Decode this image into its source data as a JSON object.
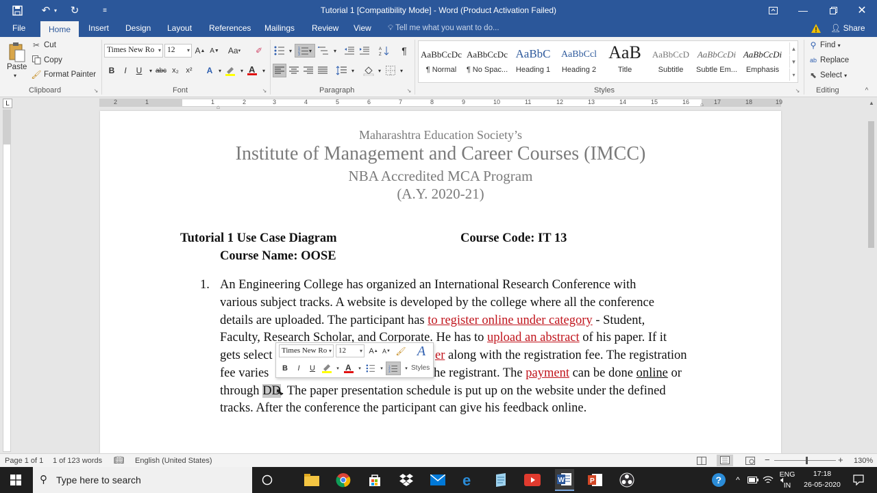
{
  "window": {
    "title": "Tutorial 1 [Compatibility Mode] - Word (Product Activation Failed)"
  },
  "quick_access": {
    "save_icon": "save-icon",
    "undo_icon": "undo-icon",
    "redo_icon": "redo-icon",
    "customize_icon": "customize-icon"
  },
  "tabs": [
    "File",
    "Home",
    "Insert",
    "Design",
    "Layout",
    "References",
    "Mailings",
    "Review",
    "View"
  ],
  "active_tab": "Home",
  "tell_me": "Tell me what you want to do...",
  "share": "Share",
  "clipboard": {
    "paste": "Paste",
    "cut": "Cut",
    "copy": "Copy",
    "format_painter": "Format Painter",
    "label": "Clipboard"
  },
  "font": {
    "name": "Times New Ro",
    "size": "12",
    "label": "Font",
    "grow": "A",
    "shrink": "A",
    "case": "Aa",
    "bold": "B",
    "italic": "I",
    "underline": "U",
    "strike": "abc",
    "sub": "x₂",
    "sup": "x²"
  },
  "paragraph": {
    "label": "Paragraph"
  },
  "styles": {
    "label": "Styles",
    "items": [
      {
        "preview": "AaBbCcDc",
        "name": "¶ Normal"
      },
      {
        "preview": "AaBbCcDc",
        "name": "¶ No Spac..."
      },
      {
        "preview": "AaBbC",
        "name": "Heading 1"
      },
      {
        "preview": "AaBbCcl",
        "name": "Heading 2"
      },
      {
        "preview": "AaB",
        "name": "Title"
      },
      {
        "preview": "AaBbCcD",
        "name": "Subtitle"
      },
      {
        "preview": "AaBbCcDi",
        "name": "Subtle Em..."
      },
      {
        "preview": "AaBbCcDi",
        "name": "Emphasis"
      }
    ]
  },
  "editing": {
    "find": "Find",
    "replace": "Replace",
    "select": "Select",
    "label": "Editing"
  },
  "ruler": {
    "numbers": [
      "2",
      "1",
      "1",
      "2",
      "3",
      "4",
      "5",
      "6",
      "7",
      "8",
      "9",
      "10",
      "11",
      "12",
      "13",
      "14",
      "15",
      "16",
      "17",
      "18",
      "19"
    ]
  },
  "document": {
    "header1": "Maharashtra Education Society’s",
    "header2": "Institute of Management and Career Courses (IMCC)",
    "header3": "NBA Accredited MCA Program",
    "header4": "(A.Y. 2020-21)",
    "tutorial": "Tutorial 1 Use Case Diagram",
    "course_code": "Course Code: IT 13",
    "course_name": "Course Name: OOSE",
    "list_num": "1.",
    "l1": "An Engineering College has organized an International Research Conference with",
    "l2": "various subject tracks. A website is developed by the college where all the conference",
    "l3a": "details are uploaded. The participant has ",
    "l3b": "to register online under category",
    "l3c": " - Student,",
    "l4a": "Faculty, Research Scholar, and Corporate. He has to ",
    "l4b": "upload an abstract",
    "l4c": " of his paper. If it",
    "l5a": "gets select",
    "l5b": "er",
    "l5c": " along with the registration fee. The registration",
    "l6a": "fee varies",
    "l6b": "he registrant. The ",
    "l6c": "payment",
    "l6d": " can be done ",
    "l6e": "online",
    "l6f": " or",
    "l7a": "through ",
    "l7b": "DD",
    "l7c": ". The paper presentation schedule is put up on the website under the defined",
    "l8": "tracks. After the conference the participant can give his feedback online."
  },
  "mini_toolbar": {
    "font": "Times New Ro",
    "size": "12",
    "styles": "Styles"
  },
  "status": {
    "page": "Page 1 of 1",
    "words": "1 of 123 words",
    "language": "English (United States)",
    "zoom": "130%"
  },
  "taskbar": {
    "search": "Type here to search",
    "lang1": "ENG",
    "lang2": "IN",
    "time": "17:18",
    "date": "26-05-2020"
  }
}
